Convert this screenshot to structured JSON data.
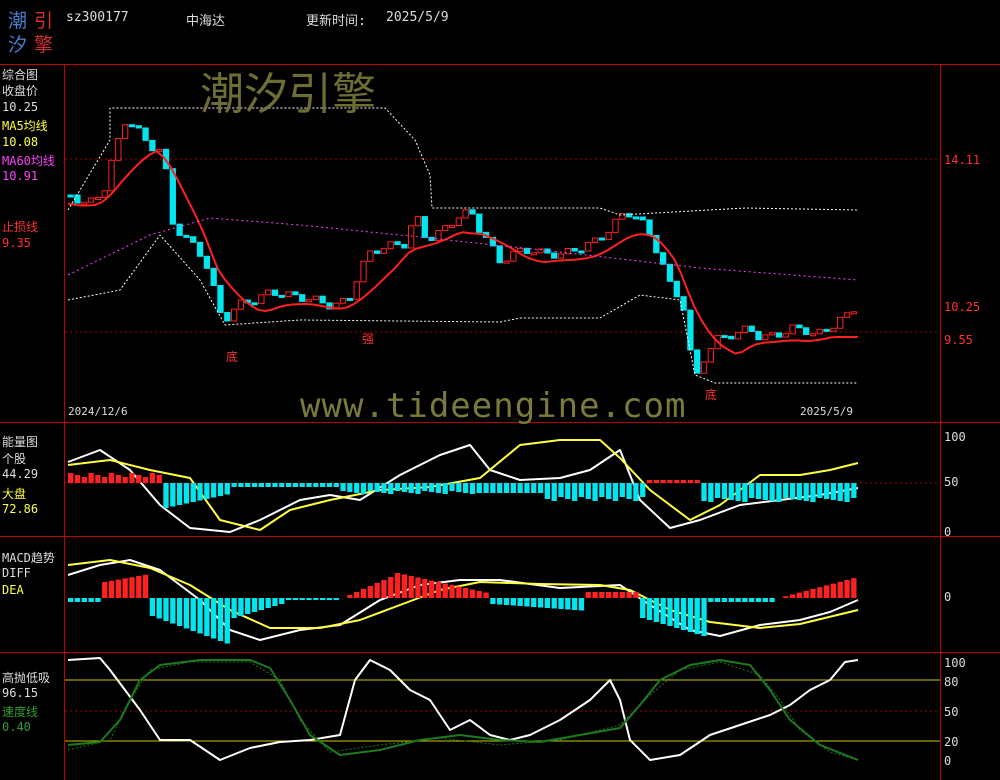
{
  "header": {
    "logo": "潮引汐擎",
    "code": "sz300177",
    "name": "中海达",
    "update_label": "更新时间:",
    "update_date": "2025/5/9"
  },
  "watermark": {
    "brand": "潮汐引擎",
    "url": "www.tideengine.com"
  },
  "colors": {
    "up": "#ff2020",
    "down": "#00e5ee",
    "yellow": "#ffff40",
    "magenta": "#ff40ff",
    "white": "#ffffff",
    "green": "#1e7a1e",
    "frame": "#c00000"
  },
  "panels": {
    "main": {
      "title": "综合图",
      "close_label": "收盘价",
      "close_value": "10.25",
      "ma5_label": "MA5均线",
      "ma5_value": "10.08",
      "ma60_label": "MA60均线",
      "ma60_value": "10.91",
      "stop_label": "止损线",
      "stop_value": "9.35",
      "right_labels": [
        "14.11",
        "10.25",
        "9.55"
      ],
      "date_start": "2024/12/6",
      "date_end": "2025/5/9",
      "markers": [
        "底",
        "强",
        "底"
      ]
    },
    "energy": {
      "title": "能量图",
      "stock_label": "个股",
      "stock_value": "44.29",
      "market_label": "大盘",
      "market_value": "72.86",
      "axis": [
        "100",
        "50",
        "0"
      ]
    },
    "macd": {
      "title": "MACD趋势",
      "diff_label": "DIFF",
      "dea_label": "DEA",
      "axis": [
        "0"
      ]
    },
    "tide": {
      "title": "高抛低吸",
      "value": "96.15",
      "speed_label": "速度线",
      "speed_value": "0.40",
      "axis": [
        "100",
        "80",
        "50",
        "20",
        "0"
      ]
    }
  },
  "chart_data": [
    {
      "type": "candlestick",
      "title": "综合图",
      "x_range": [
        "2024/12/6",
        "2025/5/9"
      ],
      "y_reference_levels": [
        14.11,
        10.25,
        9.55
      ],
      "series": [
        {
          "name": "收盘价",
          "last": 10.25
        },
        {
          "name": "MA5均线",
          "last": 10.08
        },
        {
          "name": "MA60均线",
          "last": 10.91
        },
        {
          "name": "止损线",
          "last": 9.35
        }
      ]
    },
    {
      "type": "bar",
      "title": "能量图",
      "ylim": [
        0,
        100
      ],
      "series": [
        {
          "name": "个股",
          "last": 44.29
        },
        {
          "name": "大盘",
          "last": 72.86
        }
      ]
    },
    {
      "type": "bar",
      "title": "MACD趋势",
      "series": [
        {
          "name": "DIFF"
        },
        {
          "name": "DEA"
        }
      ]
    },
    {
      "type": "line",
      "title": "高抛低吸",
      "ylim": [
        0,
        100
      ],
      "reference_lines": [
        80,
        50,
        20
      ],
      "series": [
        {
          "name": "高抛低吸",
          "last": 96.15
        },
        {
          "name": "速度线",
          "last": 0.4
        }
      ]
    }
  ]
}
